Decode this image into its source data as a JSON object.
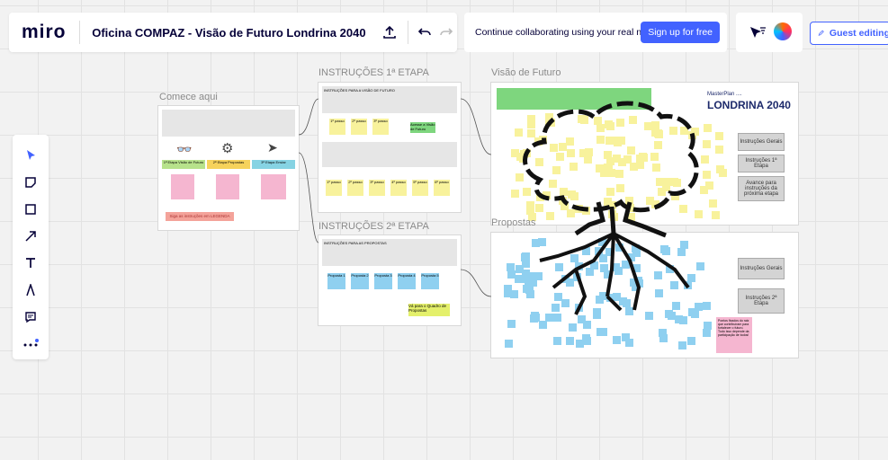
{
  "app": {
    "logo": "miro",
    "board_title": "Oficina COMPAZ - Visão de Futuro Londrina 2040"
  },
  "toolbar_top": {
    "share_icon": "upload-icon",
    "undo_icon": "undo-icon",
    "redo_icon": "redo-icon",
    "collab_text": "Continue collaborating using your real name.",
    "signup_label": "Sign up for free",
    "guest_label": "Guest editing"
  },
  "tools": [
    "select-tool",
    "sticky-note-tool",
    "shape-tool",
    "arrow-tool",
    "text-tool",
    "pen-tool",
    "comment-tool",
    "more-tool"
  ],
  "frames": {
    "comece": {
      "label": "Comece aqui",
      "button": "Siga as instruções em LEGENDA"
    },
    "etapa1": {
      "label": "INSTRUÇÕES 1ª ETAPA",
      "header": "INSTRUÇÕES PARA A VISÃO DE FUTURO",
      "link": "Acesse a Visão de Futuro"
    },
    "etapa2": {
      "label": "INSTRUÇÕES 2ª ETAPA",
      "header": "INSTRUÇÕES PARA AS PROPOSTAS",
      "link": "Vá para o Quadro de Propostas"
    },
    "visao": {
      "label": "Visão de Futuro",
      "brand_top": "MasterPlan ....",
      "brand": "LONDRINA 2040",
      "btn1": "Instruções Gerais",
      "btn2": "Instruções 1ª Etapa",
      "btn3": "Avance para instruções da próxima etapa"
    },
    "propostas": {
      "label": "Propostas",
      "btn1": "Instruções Gerais",
      "btn2": "Instruções 2ª Etapa",
      "note": "Pontos fixados do raiz que contribuíram para fortalecer o futuro. Tudo isso depende da participação de todos!"
    }
  },
  "comece_steps": [
    {
      "label": "1ª Etapa Visão de Futuro",
      "icon": "binoculars-icon"
    },
    {
      "label": "2ª Etapa Propostas",
      "icon": "gear-icon"
    },
    {
      "label": "3ª Etapa Enviar",
      "icon": "paper-plane-icon"
    }
  ],
  "etapa1_stickies": [
    "1º passo",
    "2º passo",
    "3º passo"
  ],
  "etapa1_row": [
    "1º passo",
    "2º passo",
    "3º passo",
    "4º passo",
    "5º passo",
    "6º passo"
  ],
  "etapa2_stickies": [
    "Proposta 1",
    "Proposta 2",
    "Proposta 3",
    "Proposta 4",
    "Proposta 5"
  ],
  "colors": {
    "accent": "#4262ff",
    "sticky_yellow": "#f8f29c",
    "sticky_blue": "#8fd0f0",
    "green": "#7ed67e",
    "red_button": "#f4a39a"
  }
}
